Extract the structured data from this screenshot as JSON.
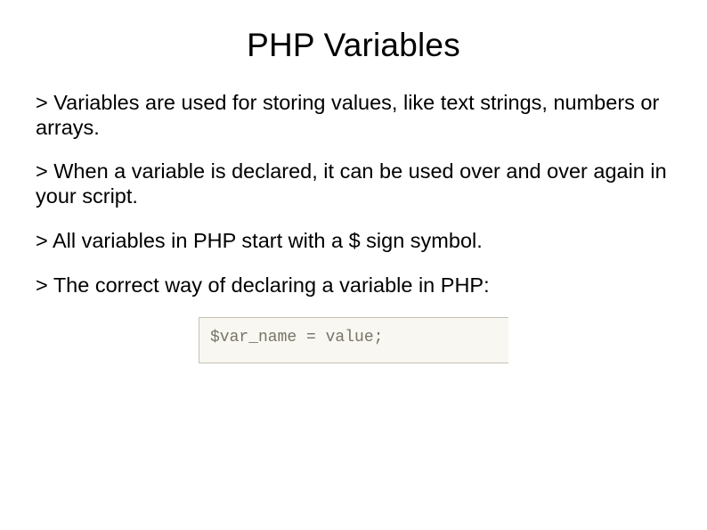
{
  "title": "PHP Variables",
  "bullets": [
    "> Variables are used for storing values, like text strings, numbers or arrays.",
    "> When a variable is declared, it can be used over and over again in your script.",
    "> All variables in PHP start with a $ sign symbol.",
    "> The correct way of declaring a variable in PHP:"
  ],
  "code_example": "$var_name = value;"
}
